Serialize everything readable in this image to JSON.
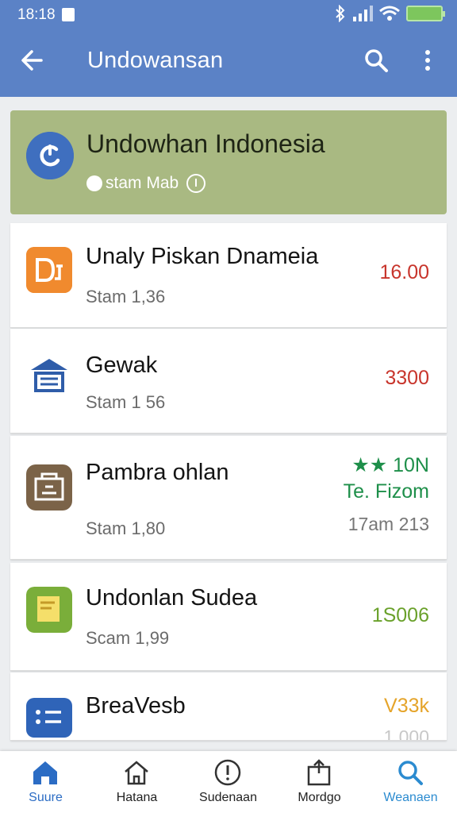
{
  "status": {
    "time": "18:18"
  },
  "appbar": {
    "title": "Undowansan"
  },
  "header": {
    "name": "Undowhan Indonesia",
    "subtitle": "stam Mab"
  },
  "colors": {
    "primary": "#5b82c6",
    "header_bg": "#a9b982",
    "amount_red": "#c8352c",
    "amount_green": "#1e8f4a",
    "amount_lime": "#6aa12b",
    "amount_amber": "#e5a42a",
    "nav_active": "#2b8bd0"
  },
  "items": [
    {
      "name": "Unaly Piskan Dnameia",
      "sub": "Stam 1,36",
      "amount": "16.00",
      "icon": "orange-app-icon"
    },
    {
      "name": "Gewak",
      "sub": "Stam 1 56",
      "amount": "3300",
      "icon": "bank-icon"
    },
    {
      "name": "Pambra ohlan",
      "sub": "Stam 1,80",
      "amount": "★★ 10N",
      "amount2": "Te. Fizom",
      "amount3": "17am 213",
      "icon": "shop-icon"
    },
    {
      "name": "Undonlan Sudea",
      "sub": "Scam 1,99",
      "amount": "1S006",
      "icon": "document-icon"
    },
    {
      "name": "BreaVesb",
      "amount": "V33k",
      "amount3": "1,000",
      "icon": "list-icon"
    }
  ],
  "nav": [
    {
      "label": "Suure",
      "icon": "home-icon"
    },
    {
      "label": "Hatana",
      "icon": "house-outline-icon"
    },
    {
      "label": "Sudenaan",
      "icon": "alert-icon"
    },
    {
      "label": "Mordgo",
      "icon": "box-icon"
    },
    {
      "label": "Weanaen",
      "icon": "search-icon"
    }
  ]
}
